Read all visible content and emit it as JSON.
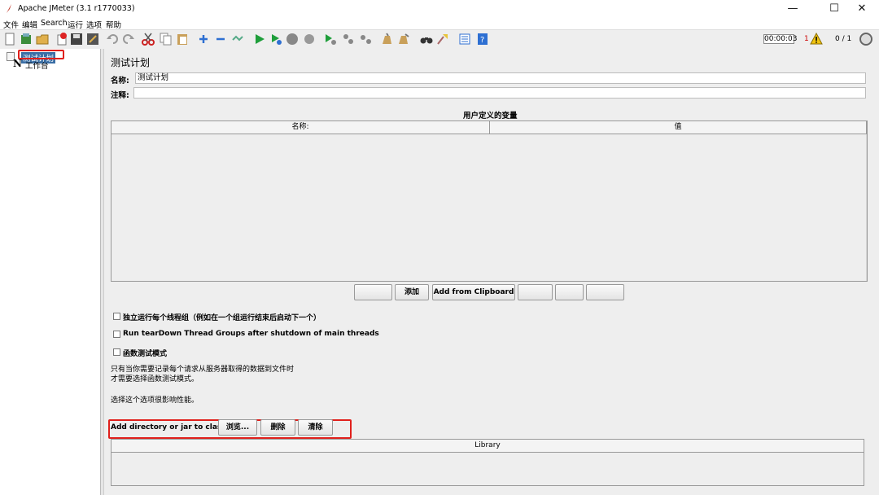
{
  "window": {
    "title": "Apache JMeter (3.1 r1770033)",
    "minimize": "—",
    "maximize": "☐",
    "close": "✕"
  },
  "menu": [
    "文件",
    "编辑",
    "Search",
    "运行",
    "选项",
    "帮助"
  ],
  "toolbar": {
    "timer": "00:00:03",
    "warnings": "1",
    "threads": "0 / 1"
  },
  "tree": {
    "test_plan": "测试计划",
    "workbench": "工作台"
  },
  "plan": {
    "title": "测试计划",
    "name_label": "名称:",
    "name_value": "测试计划",
    "comment_label": "注释:",
    "comment_value": ""
  },
  "variables": {
    "title": "用户定义的变量",
    "col_name": "名称:",
    "col_value": "值"
  },
  "buttons": {
    "add": "添加",
    "add_clipboard": "Add from Clipboard",
    "browse": "浏览...",
    "delete": "删除",
    "clear": "清除"
  },
  "options": {
    "serialize": "独立运行每个线程组（例如在一个组运行结束后启动下一个）",
    "teardown": "Run tearDown Thread Groups after shutdown of main threads",
    "functional": "函数测试模式"
  },
  "notes": {
    "line1": "只有当你需要记录每个请求从服务器取得的数据到文件时",
    "line2": "才需要选择函数测试模式。",
    "line3": "选择这个选项很影响性能。"
  },
  "classpath": {
    "label": "Add directory or jar to classpath",
    "col": "Library"
  },
  "colors": {
    "highlight": "#e0201c",
    "selection": "#3a6ea5",
    "panel": "#eeeeee"
  }
}
